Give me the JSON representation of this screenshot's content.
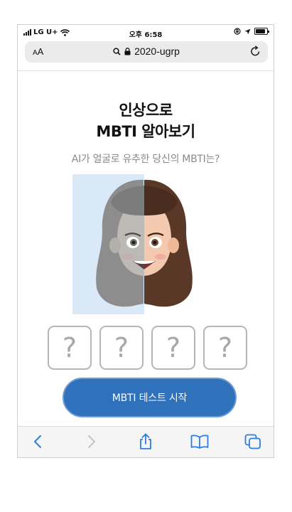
{
  "status_bar": {
    "carrier": "LG U+",
    "time": "오후 6:58"
  },
  "address_bar": {
    "text_size_label_small": "A",
    "text_size_label_large": "A",
    "url": "2020-ugrp"
  },
  "content": {
    "title_line1": "인상으로",
    "title_line2": "MBTI 알아보기",
    "subtitle": "AI가 얼굴로 유추한 당신의 MBTI는?",
    "mbti_slots": [
      "?",
      "?",
      "?",
      "?"
    ],
    "start_button_label": "MBTI 테스트 시작"
  },
  "toolbar": {
    "items": [
      "back-icon",
      "forward-icon",
      "share-icon",
      "bookmarks-icon",
      "tabs-icon"
    ]
  },
  "colors": {
    "accent": "#2f71ba",
    "ios_blue": "#2a7de1",
    "scan_overlay": "#dae9f7"
  }
}
